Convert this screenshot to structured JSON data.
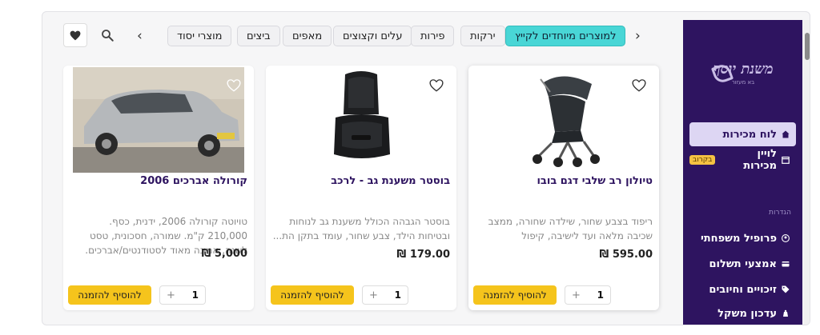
{
  "header": {
    "categories": [
      {
        "label": "למוצרים מיוחדים לקייץ",
        "active": true
      },
      {
        "label": "ירקות",
        "active": false
      },
      {
        "label": "פירות",
        "active": false
      },
      {
        "label": "עלים וקצוצים",
        "active": false
      },
      {
        "label": "מאפים",
        "active": false
      },
      {
        "label": "ביצים",
        "active": false
      },
      {
        "label": "מוצרי יסוד",
        "active": false
      }
    ],
    "arrow_left_icon": "chevron-left-icon",
    "arrow_right_icon": "chevron-right-icon",
    "search_icon": "search-icon",
    "favorites_icon": "heart-icon"
  },
  "sidebar": {
    "logo_main": "משנת יוסף",
    "logo_sub": "בא מעזור",
    "items": [
      {
        "label": "לוח מכירות",
        "icon": "home-icon",
        "active": true
      },
      {
        "label": "לויין מכירות",
        "icon": "calendar-icon",
        "active": false,
        "badge": "בקרוב"
      }
    ],
    "section_label": "הגדרות",
    "settings_items": [
      {
        "label": "פרופיל משפחתי",
        "icon": "user-icon"
      },
      {
        "label": "אמצעי תשלום",
        "icon": "card-icon"
      },
      {
        "label": "זיכויים וחיובים",
        "icon": "tag-icon"
      },
      {
        "label": "עדכון משקל",
        "icon": "scale-icon"
      }
    ]
  },
  "products": [
    {
      "title": "טיולון רב שלבי דגם בובו",
      "description": "ריפוד בצבע שחור, שילדה שחורה, ממצב שכיבה מלאה ועד לישיבה, קיפול קומפקטי...",
      "price": "595.00 ₪",
      "quantity": "1",
      "add_label": "להוסיף להזמנה",
      "image": "stroller"
    },
    {
      "title": "בוסטר משענת גב - לרכב",
      "description": "בוסטר הגבהה הכולל משענת גב לנוחות ובטיחות הילד, צבע שחור, עומד בתקן הת...",
      "price": "179.00 ₪",
      "quantity": "1",
      "add_label": "להוסיף להזמנה",
      "image": "booster-seat"
    },
    {
      "title": "קורולה אברכים 2006",
      "description": "טויוטה קורולה 2006, ידנית, כסף. 210,000 ק\"מ. שמורה, חסכונית, טסט לשנה, אמינה מאוד לסטודנטים/אברכים. במצב טוב.",
      "price": "5,000 ₪",
      "quantity": "1",
      "add_label": "להוסיף להזמנה",
      "image": "car"
    }
  ],
  "colors": {
    "sidebar_bg": "#2e1460",
    "accent_chip": "#49d6d6",
    "add_button": "#f5c41c",
    "title_color": "#2e1460"
  }
}
